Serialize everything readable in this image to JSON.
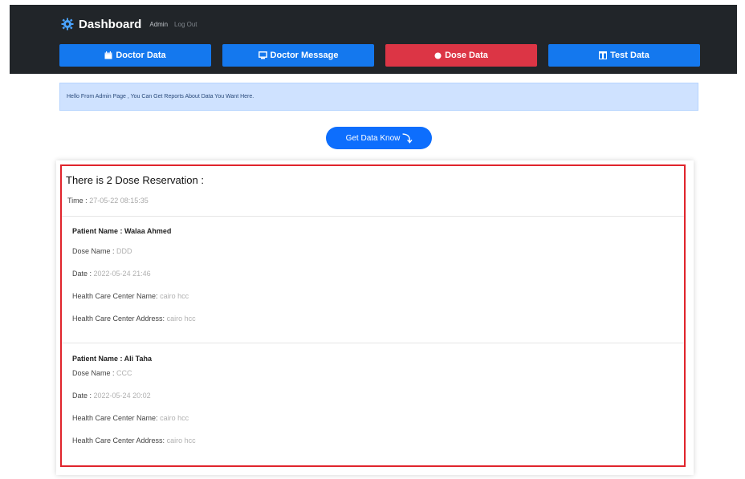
{
  "header": {
    "title": "Dashboard",
    "admin_label": "Admin",
    "logout_label": "Log Out"
  },
  "nav": {
    "doctor_data": "Doctor Data",
    "doctor_message": "Doctor Message",
    "dose_data": "Dose Data",
    "test_data": "Test Data"
  },
  "alert": {
    "text": "Hello From Admin Page , You Can Get Reports About Data You Want Here."
  },
  "get_data": {
    "label": "Get Data Know"
  },
  "card": {
    "title": "There is 2 Dose Reservation :",
    "time_label": "Time :",
    "time_value": "27-05-22 08:15:35",
    "entries": [
      {
        "patient_label": "Patient Name : Walaa Ahmed",
        "dose_label": "Dose Name :",
        "dose_value": "DDD",
        "date_label": "Date :",
        "date_value": "2022-05-24 21:46",
        "center_name_label": "Health Care Center Name:",
        "center_name_value": "cairo hcc",
        "center_address_label": "Health Care Center Address:",
        "center_address_value": "cairo hcc"
      },
      {
        "patient_label": "Patient Name : Ali Taha",
        "dose_label": "Dose Name :",
        "dose_value": "CCC",
        "date_label": "Date :",
        "date_value": "2022-05-24 20:02",
        "center_name_label": "Health Care Center Name:",
        "center_name_value": "cairo hcc",
        "center_address_label": "Health Care Center Address:",
        "center_address_value": "cairo hcc"
      }
    ]
  },
  "colors": {
    "header_bg": "#212529",
    "nav_blue": "#1478ee",
    "nav_red": "#dc3545",
    "alert_bg": "#cfe2ff",
    "button_blue": "#0d6efd",
    "highlight_border": "#e0242c"
  }
}
